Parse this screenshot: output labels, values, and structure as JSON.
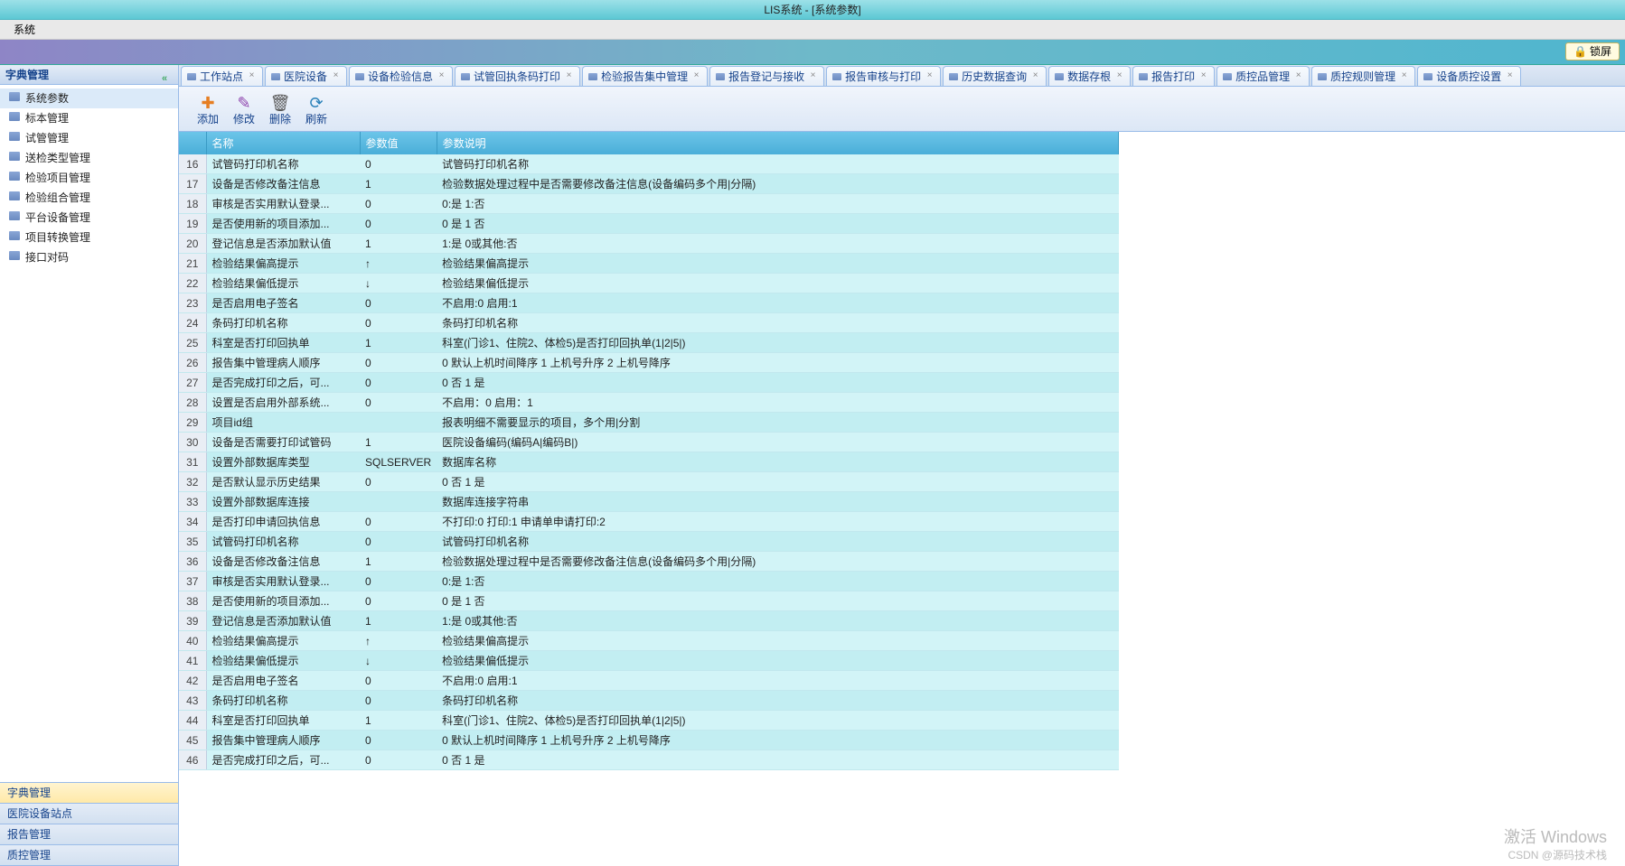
{
  "window": {
    "title": "LIS系统 - [系统参数]"
  },
  "menubar": {
    "system": "系统"
  },
  "toolbar": {
    "lock": "锁屏"
  },
  "sidebar": {
    "title": "字典管理",
    "items": [
      {
        "label": "系统参数",
        "selected": true
      },
      {
        "label": "标本管理"
      },
      {
        "label": "试管管理"
      },
      {
        "label": "送检类型管理"
      },
      {
        "label": "检验项目管理"
      },
      {
        "label": "检验组合管理"
      },
      {
        "label": "平台设备管理"
      },
      {
        "label": "项目转换管理"
      },
      {
        "label": "接口对码"
      }
    ],
    "accordion": [
      {
        "label": "字典管理",
        "active": true
      },
      {
        "label": "医院设备站点"
      },
      {
        "label": "报告管理"
      },
      {
        "label": "质控管理"
      }
    ]
  },
  "tabs": [
    {
      "label": "工作站点"
    },
    {
      "label": "医院设备"
    },
    {
      "label": "设备检验信息"
    },
    {
      "label": "试管回执条码打印"
    },
    {
      "label": "检验报告集中管理"
    },
    {
      "label": "报告登记与接收"
    },
    {
      "label": "报告审核与打印"
    },
    {
      "label": "历史数据查询"
    },
    {
      "label": "数据存根"
    },
    {
      "label": "报告打印"
    },
    {
      "label": "质控品管理"
    },
    {
      "label": "质控规则管理"
    },
    {
      "label": "设备质控设置"
    }
  ],
  "actions": {
    "add": "添加",
    "edit": "修改",
    "del": "删除",
    "refresh": "刷新"
  },
  "grid": {
    "headers": {
      "name": "名称",
      "value": "参数值",
      "desc": "参数说明"
    },
    "rows": [
      {
        "n": 16,
        "name": "试管码打印机名称",
        "value": "0",
        "desc": "试管码打印机名称"
      },
      {
        "n": 17,
        "name": "设备是否修改备注信息",
        "value": "1",
        "desc": "检验数据处理过程中是否需要修改备注信息(设备编码多个用|分隔)"
      },
      {
        "n": 18,
        "name": "审核是否实用默认登录...",
        "value": "0",
        "desc": "0:是 1:否"
      },
      {
        "n": 19,
        "name": "是否使用新的项目添加...",
        "value": "0",
        "desc": "0 是 1 否"
      },
      {
        "n": 20,
        "name": "登记信息是否添加默认值",
        "value": "1",
        "desc": "1:是 0或其他:否"
      },
      {
        "n": 21,
        "name": "检验结果偏高提示",
        "value": "↑",
        "desc": "检验结果偏高提示"
      },
      {
        "n": 22,
        "name": "检验结果偏低提示",
        "value": "↓",
        "desc": "检验结果偏低提示"
      },
      {
        "n": 23,
        "name": "是否启用电子签名",
        "value": "0",
        "desc": "不启用:0 启用:1"
      },
      {
        "n": 24,
        "name": "条码打印机名称",
        "value": "0",
        "desc": "条码打印机名称"
      },
      {
        "n": 25,
        "name": "科室是否打印回执单",
        "value": "1",
        "desc": "科室(门诊1、住院2、体检5)是否打印回执单(1|2|5|)"
      },
      {
        "n": 26,
        "name": "报告集中管理病人顺序",
        "value": "0",
        "desc": "0 默认上机时间降序   1 上机号升序   2 上机号降序"
      },
      {
        "n": 27,
        "name": "是否完成打印之后，可...",
        "value": "0",
        "desc": "0 否 1 是"
      },
      {
        "n": 28,
        "name": "设置是否启用外部系统...",
        "value": "0",
        "desc": "不启用：0 启用：1"
      },
      {
        "n": 29,
        "name": "项目id组",
        "value": "",
        "desc": "报表明细不需要显示的项目，多个用|分割"
      },
      {
        "n": 30,
        "name": "设备是否需要打印试管码",
        "value": "1",
        "desc": "医院设备编码(编码A|编码B|)"
      },
      {
        "n": 31,
        "name": "设置外部数据库类型",
        "value": "SQLSERVER",
        "desc": "数据库名称"
      },
      {
        "n": 32,
        "name": "是否默认显示历史结果",
        "value": "0",
        "desc": "0 否  1 是"
      },
      {
        "n": 33,
        "name": "设置外部数据库连接",
        "value": "",
        "desc": "数据库连接字符串"
      },
      {
        "n": 34,
        "name": "是否打印申请回执信息",
        "value": "0",
        "desc": "不打印:0 打印:1 申请单申请打印:2"
      },
      {
        "n": 35,
        "name": "试管码打印机名称",
        "value": "0",
        "desc": "试管码打印机名称"
      },
      {
        "n": 36,
        "name": "设备是否修改备注信息",
        "value": "1",
        "desc": "检验数据处理过程中是否需要修改备注信息(设备编码多个用|分隔)"
      },
      {
        "n": 37,
        "name": "审核是否实用默认登录...",
        "value": "0",
        "desc": "0:是 1:否"
      },
      {
        "n": 38,
        "name": "是否使用新的项目添加...",
        "value": "0",
        "desc": "0 是 1 否"
      },
      {
        "n": 39,
        "name": "登记信息是否添加默认值",
        "value": "1",
        "desc": "1:是 0或其他:否"
      },
      {
        "n": 40,
        "name": "检验结果偏高提示",
        "value": "↑",
        "desc": "检验结果偏高提示"
      },
      {
        "n": 41,
        "name": "检验结果偏低提示",
        "value": "↓",
        "desc": "检验结果偏低提示"
      },
      {
        "n": 42,
        "name": "是否启用电子签名",
        "value": "0",
        "desc": "不启用:0 启用:1"
      },
      {
        "n": 43,
        "name": "条码打印机名称",
        "value": "0",
        "desc": "条码打印机名称"
      },
      {
        "n": 44,
        "name": "科室是否打印回执单",
        "value": "1",
        "desc": "科室(门诊1、住院2、体检5)是否打印回执单(1|2|5|)"
      },
      {
        "n": 45,
        "name": "报告集中管理病人顺序",
        "value": "0",
        "desc": "0 默认上机时间降序   1 上机号升序   2 上机号降序"
      },
      {
        "n": 46,
        "name": "是否完成打印之后，可...",
        "value": "0",
        "desc": "0 否 1 是"
      }
    ]
  },
  "watermark": {
    "line1": "激活 Windows",
    "line2": "CSDN @源码技术栈"
  }
}
